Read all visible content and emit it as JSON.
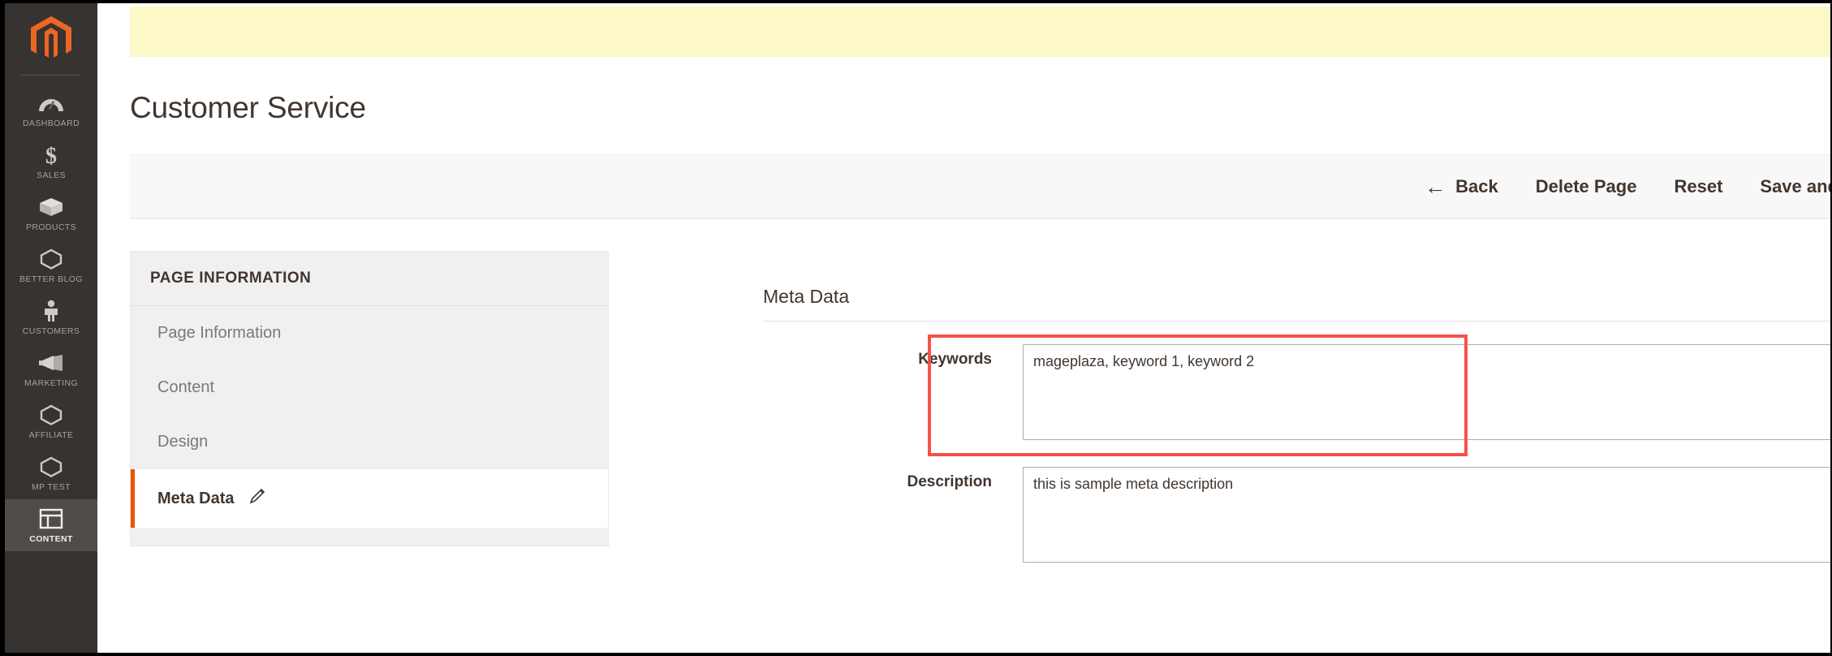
{
  "sidebar": {
    "logo_name": "magento-logo",
    "items": [
      {
        "label": "DASHBOARD",
        "icon": "dashboard-gauge-icon",
        "active": false
      },
      {
        "label": "SALES",
        "icon": "dollar-sign-icon",
        "active": false
      },
      {
        "label": "PRODUCTS",
        "icon": "box-icon",
        "active": false
      },
      {
        "label": "BETTER BLOG",
        "icon": "hexagon-icon",
        "active": false
      },
      {
        "label": "CUSTOMERS",
        "icon": "person-icon",
        "active": false
      },
      {
        "label": "MARKETING",
        "icon": "megaphone-icon",
        "active": false
      },
      {
        "label": "AFFILIATE",
        "icon": "hexagon-icon",
        "active": false
      },
      {
        "label": "MP TEST",
        "icon": "hexagon-icon",
        "active": false
      },
      {
        "label": "CONTENT",
        "icon": "layout-grid-icon",
        "active": true
      }
    ]
  },
  "header": {
    "page_title": "Customer Service"
  },
  "toolbar": {
    "back_label": "Back",
    "back_icon": "arrow-left-icon",
    "delete_label": "Delete Page",
    "reset_label": "Reset",
    "save_label": "Save and"
  },
  "left_panel": {
    "header": "PAGE INFORMATION",
    "items": [
      {
        "label": "Page Information"
      },
      {
        "label": "Content"
      },
      {
        "label": "Design"
      },
      {
        "label": "Meta Data"
      }
    ],
    "active_item_index": 3,
    "active_icon": "pencil-edit-icon"
  },
  "form": {
    "section_title": "Meta Data",
    "fields": [
      {
        "label": "Keywords",
        "value": "mageplaza, keyword 1, keyword 2"
      },
      {
        "label": "Description",
        "value": "this is sample meta description"
      }
    ]
  },
  "colors": {
    "accent_orange": "#eb5202",
    "sidebar_bg": "#373330",
    "notice_yellow": "#fcf8c8",
    "highlight_red": "#f4524d"
  }
}
